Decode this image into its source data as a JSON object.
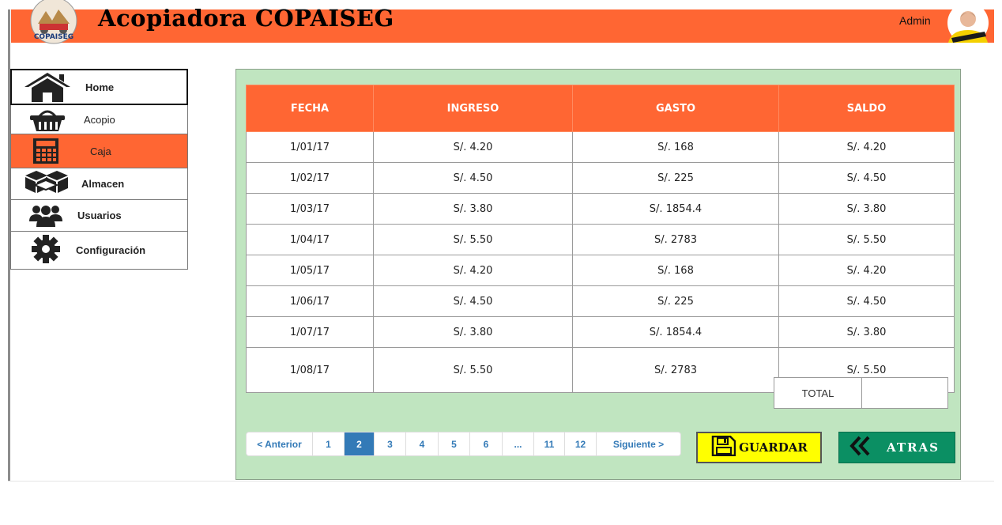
{
  "header": {
    "title": "Acopiadora COPAISEG",
    "logo_text": "COPAISEG",
    "user_label": "Admin"
  },
  "sidebar": {
    "items": [
      {
        "label": "Home",
        "icon": "home-icon"
      },
      {
        "label": "Acopio",
        "icon": "basket-icon"
      },
      {
        "label": "Caja",
        "icon": "calculator-icon"
      },
      {
        "label": "Almacen",
        "icon": "boxes-icon"
      },
      {
        "label": "Usuarios",
        "icon": "users-icon"
      },
      {
        "label": "Configuración",
        "icon": "gear-icon"
      }
    ],
    "active": "Caja"
  },
  "table": {
    "headers": [
      "FECHA",
      "INGRESO",
      "GASTO",
      "SALDO"
    ],
    "rows": [
      [
        "1/01/17",
        "S/. 4.20",
        "S/. 168",
        "S/. 4.20"
      ],
      [
        "1/02/17",
        "S/. 4.50",
        "S/. 225",
        "S/. 4.50"
      ],
      [
        "1/03/17",
        "S/. 3.80",
        "S/. 1854.4",
        "S/. 3.80"
      ],
      [
        "1/04/17",
        "S/. 5.50",
        "S/. 2783",
        "S/. 5.50"
      ],
      [
        "1/05/17",
        "S/. 4.20",
        "S/. 168",
        "S/. 4.20"
      ],
      [
        "1/06/17",
        "S/. 4.50",
        "S/. 225",
        "S/. 4.50"
      ],
      [
        "1/07/17",
        "S/. 3.80",
        "S/. 1854.4",
        "S/. 3.80"
      ],
      [
        "1/08/17",
        "S/. 5.50",
        "S/. 2783",
        "S/. 5.50"
      ]
    ],
    "total_label": "TOTAL",
    "total_value": ""
  },
  "pagination": {
    "prev": "< Anterior",
    "pages": [
      "1",
      "2",
      "3",
      "4",
      "5",
      "6",
      "...",
      "11",
      "12"
    ],
    "current": "2",
    "next": "Siguiente >"
  },
  "buttons": {
    "save": "GUARDAR",
    "back": "ATRAS"
  },
  "colors": {
    "header": "#ff6633",
    "panel": "#c0e5c0",
    "save_button": "#ffff00",
    "back_button": "#0b8f63",
    "active_page": "#337ab7"
  }
}
